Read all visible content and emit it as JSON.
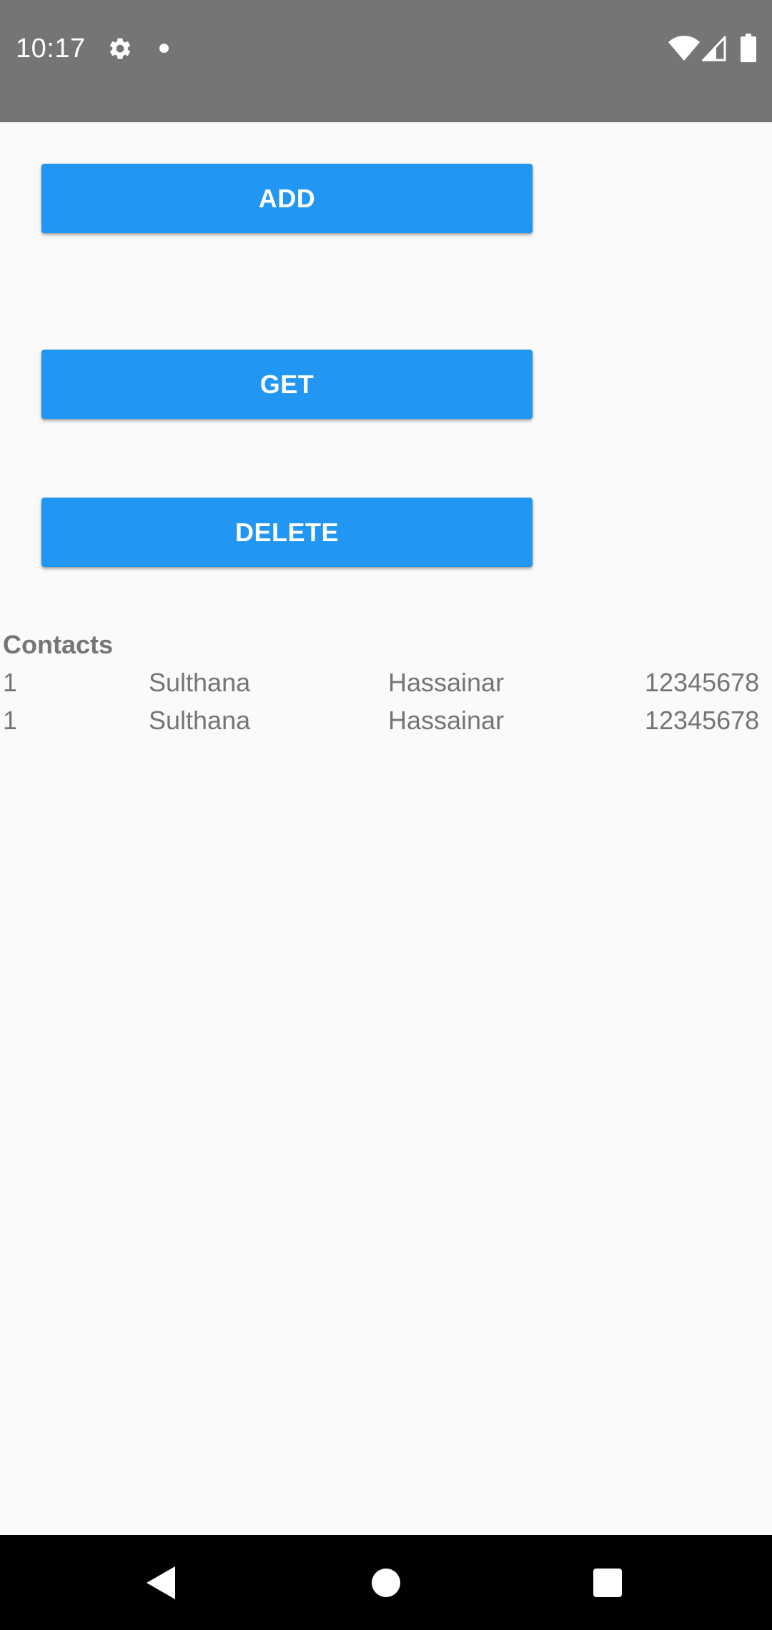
{
  "status_bar": {
    "time": "10:17",
    "icons": [
      "gear-icon",
      "notification-dot-icon",
      "wifi-icon",
      "cell-signal-icon",
      "battery-icon"
    ],
    "background": "#757575"
  },
  "buttons": {
    "add_label": "ADD",
    "get_label": "GET",
    "delete_label": "DELETE",
    "color": "#2196f3"
  },
  "contacts": {
    "title": "Contacts",
    "rows": [
      {
        "id": "1",
        "first_name": "Sulthana",
        "last_name": "Hassainar",
        "phone": "12345678"
      },
      {
        "id": "1",
        "first_name": "Sulthana",
        "last_name": "Hassainar",
        "phone": "12345678"
      }
    ]
  },
  "nav_bar": {
    "icons": [
      "back-icon",
      "home-icon",
      "recents-icon"
    ]
  }
}
